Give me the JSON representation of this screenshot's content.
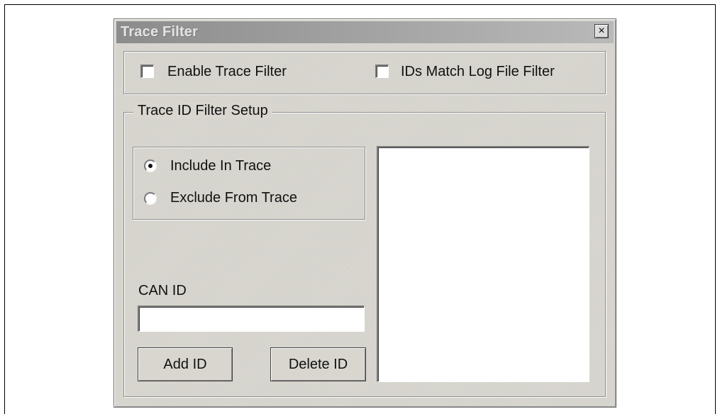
{
  "dialog": {
    "title": "Trace Filter",
    "close_glyph": "×"
  },
  "options": {
    "enable_trace_filter": {
      "label": "Enable Trace Filter",
      "checked": false
    },
    "ids_match_log_file_filter": {
      "label": "IDs Match Log File Filter",
      "checked": false
    }
  },
  "setup": {
    "legend": "Trace ID Filter Setup",
    "radios": [
      {
        "label": "Include In Trace",
        "selected": true
      },
      {
        "label": "Exclude From Trace",
        "selected": false
      }
    ],
    "can_id_label": "CAN ID",
    "can_id_value": "",
    "add_button": "Add ID",
    "delete_button": "Delete ID",
    "id_list": []
  },
  "icons": {
    "close": "close-icon"
  }
}
